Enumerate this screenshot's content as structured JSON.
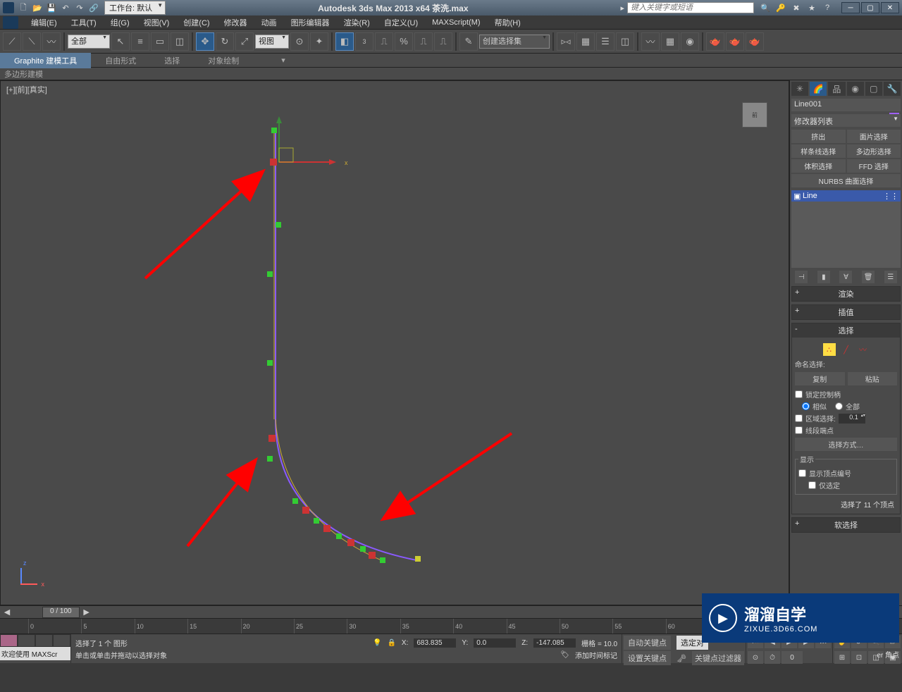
{
  "titlebar": {
    "workspace_label": "工作台: 默认",
    "app_title": "Autodesk 3ds Max  2013 x64    茶洗.max",
    "search_placeholder": "键入关键字或短语"
  },
  "menubar": {
    "items": [
      "编辑(E)",
      "工具(T)",
      "组(G)",
      "视图(V)",
      "创建(C)",
      "修改器",
      "动画",
      "图形编辑器",
      "渲染(R)",
      "自定义(U)",
      "MAXScript(M)",
      "帮助(H)"
    ]
  },
  "toolbar": {
    "filter_all": "全部",
    "ref_coord": "视图",
    "named_sel": "创建选择集"
  },
  "ribbon": {
    "tabs": [
      "Graphite 建模工具",
      "自由形式",
      "选择",
      "对象绘制"
    ],
    "sub": "多边形建模"
  },
  "viewport": {
    "label": "[+][前][真实]",
    "cube_face": "前"
  },
  "cmd_panel": {
    "object_name": "Line001",
    "modifier_list": "修改器列表",
    "mod_buttons": [
      "挤出",
      "面片选择",
      "样条线选择",
      "多边形选择",
      "体积选择",
      "FFD 选择",
      "NURBS 曲面选择"
    ],
    "stack_item": "Line",
    "rollouts": {
      "render": "渲染",
      "interp": "插值",
      "selection": "选择",
      "soft": "软选择"
    },
    "named_sel_label": "命名选择:",
    "copy": "复制",
    "paste": "粘贴",
    "lock_handles": "锁定控制柄",
    "radio_similar": "相似",
    "radio_all": "全部",
    "area_sel": "区域选择:",
    "area_val": "0.1",
    "seg_end": "线段端点",
    "sel_mode": "选择方式…",
    "display_group": "显示",
    "show_vtx_num": "显示顶点编号",
    "only_sel": "仅选定",
    "selected_info": "选择了 11 个顶点",
    "corner": "er 角点"
  },
  "timeline": {
    "slider": "0 / 100",
    "ticks": [
      "0",
      "5",
      "10",
      "15",
      "20",
      "25",
      "30",
      "35",
      "40",
      "45",
      "50",
      "55",
      "60"
    ]
  },
  "statusbar": {
    "welcome": "欢迎使用 MAXScr",
    "sel_msg": "选择了 1 个 图形",
    "hint": "单击或单击并拖动以选择对象",
    "x": "683.835",
    "y": "0.0",
    "z": "-147.085",
    "grid_label": "栅格 = 10.0",
    "add_time_tag": "添加时间标记",
    "auto_key": "自动关键点",
    "set_key": "设置关键点",
    "sel_label": "选定对",
    "key_filter": "关键点过滤器"
  },
  "watermark": {
    "big": "溜溜自学",
    "small": "ZIXUE.3D66.COM"
  }
}
